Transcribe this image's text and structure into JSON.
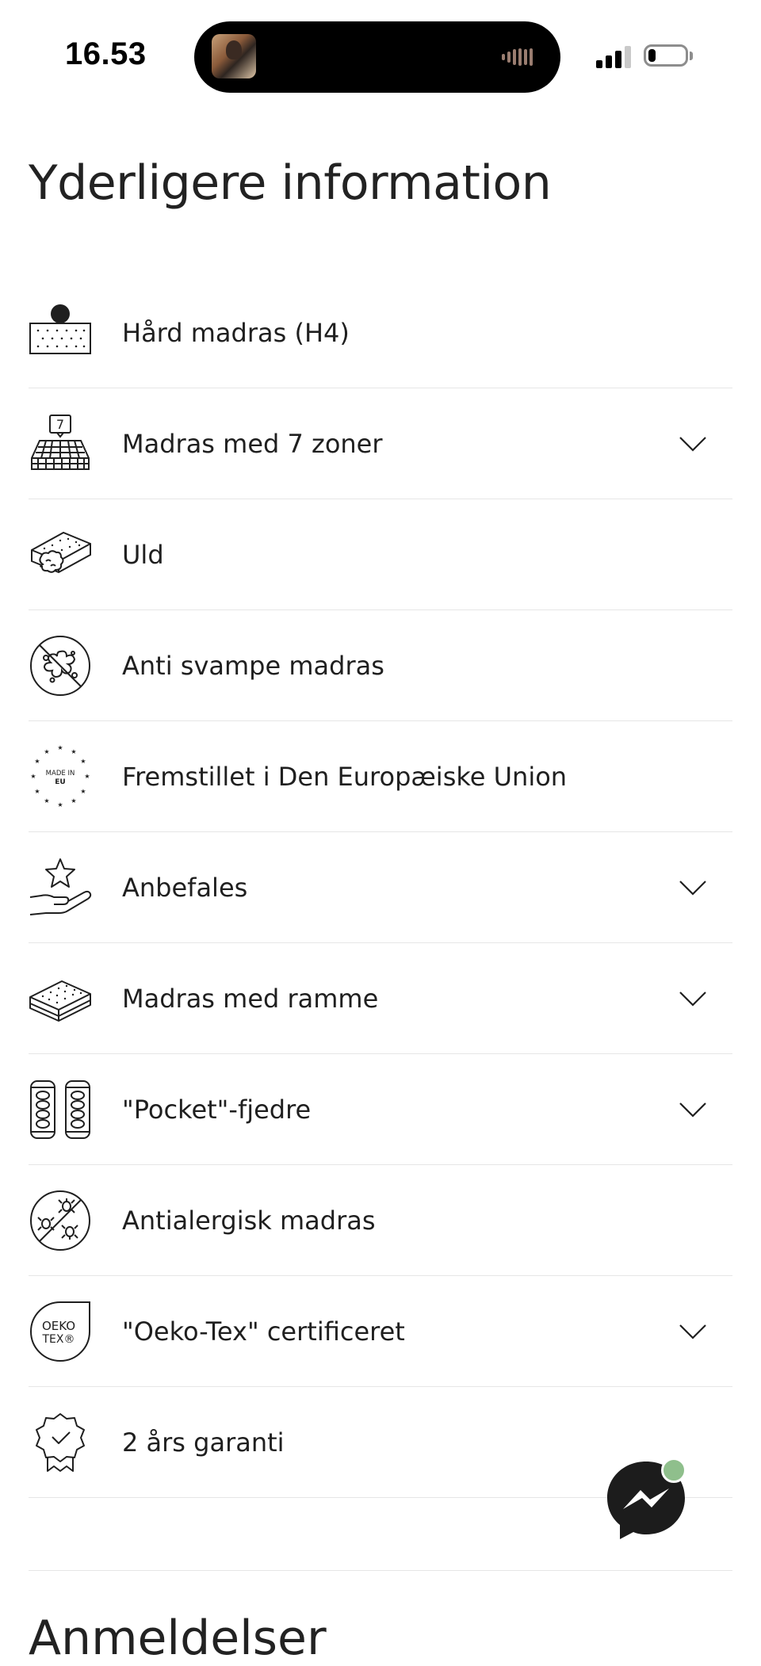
{
  "status_bar": {
    "time": "16.53",
    "now_playing_icon": "album-art-thumbnail",
    "signal_icon": "cellular-signal-icon",
    "battery_icon": "battery-low-icon"
  },
  "section": {
    "title": "Yderligere information"
  },
  "features": [
    {
      "icon": "hard-mattress-icon",
      "label": "Hård madras (H4)",
      "expandable": false
    },
    {
      "icon": "seven-zones-icon",
      "label": "Madras med 7 zoner",
      "expandable": true
    },
    {
      "icon": "wool-icon",
      "label": "Uld",
      "expandable": false
    },
    {
      "icon": "anti-fungal-icon",
      "label": "Anti svampe madras",
      "expandable": false
    },
    {
      "icon": "made-in-eu-icon",
      "label": "Fremstillet i Den Europæiske Union",
      "expandable": false,
      "icon_text": [
        "MADE IN",
        "EU"
      ]
    },
    {
      "icon": "recommended-hand-star-icon",
      "label": "Anbefales",
      "expandable": true
    },
    {
      "icon": "mattress-frame-icon",
      "label": "Madras med ramme",
      "expandable": true
    },
    {
      "icon": "pocket-springs-icon",
      "label": "\"Pocket\"-fjedre",
      "expandable": true
    },
    {
      "icon": "anti-allergy-icon",
      "label": "Antialergisk madras",
      "expandable": false
    },
    {
      "icon": "oeko-tex-icon",
      "label": "\"Oeko-Tex\" certificeret",
      "expandable": true,
      "icon_text": [
        "OEKO",
        "TEX®"
      ]
    },
    {
      "icon": "warranty-badge-icon",
      "label": "2 års garanti",
      "expandable": false
    }
  ],
  "zone_icon_number": "7",
  "reviews": {
    "title": "Anmeldelser"
  },
  "chat": {
    "icon": "messenger-icon",
    "notification_color": "#8fbf8c"
  }
}
